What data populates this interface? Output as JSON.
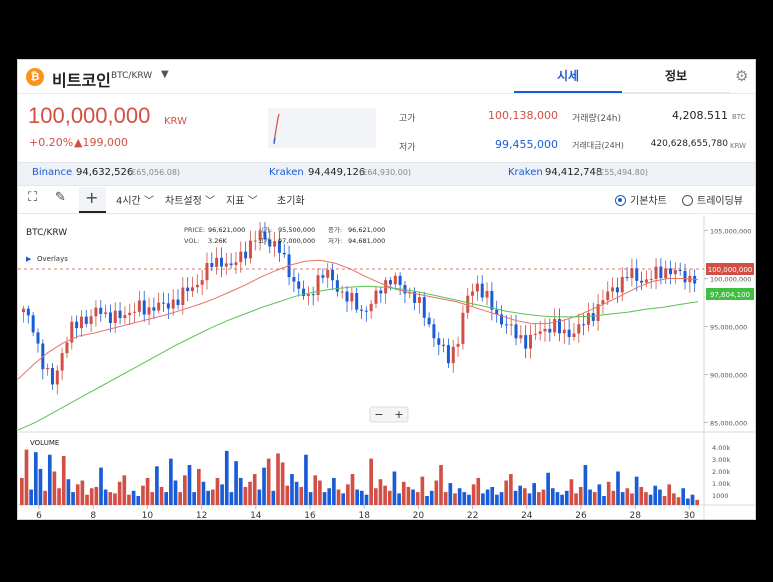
{
  "coin": {
    "logo": "₿",
    "name": "비트코인",
    "pair": "BTC/KRW",
    "caret": "▼"
  },
  "tabs": {
    "market": "시세",
    "info": "정보"
  },
  "icons": {
    "gear": "gear-icon",
    "expand": "expand-icon",
    "pencil": "pencil-icon",
    "crosshair": "crosshair-icon"
  },
  "price": {
    "value": "100,000,000",
    "unit": "KRW",
    "change_pct": "+0.20%",
    "change_amt": "▲199,000"
  },
  "stats": {
    "high_label": "고가",
    "high": "100,138,000",
    "low_label": "저가",
    "low": "99,455,000",
    "volume_label": "거래량(24h)",
    "volume": "4,208.511",
    "volume_unit": "BTC",
    "value_label": "거래대금(24H)",
    "value": "420,628,655,780",
    "value_unit": "KRW"
  },
  "exchanges": [
    {
      "name": "Binance",
      "price": "94,632,526",
      "sub": "(€65,056.08)"
    },
    {
      "name": "Kraken",
      "price": "94,449,126",
      "sub": "(€64,930.00)"
    },
    {
      "name": "Kraken",
      "price": "94,412,748",
      "sub": "(£55,494.80)"
    }
  ],
  "toolbar": {
    "interval": "4시간 ﹀",
    "chart_settings": "차트설정 ﹀",
    "indicators": "지표 ﹀",
    "reset": "초기화",
    "basic_chart": "기본차트",
    "tradingview": "트레이딩뷰"
  },
  "chart_legend": {
    "symbol": "BTC/KRW",
    "overlays": "Overlays",
    "price_label": "PRICE:",
    "price": "96,621,000",
    "open_label": "시가:",
    "open": "95,500,000",
    "close_label": "종가:",
    "close": "96,621,000",
    "vol_label": "VOL:",
    "vol": "3.26K",
    "high_label": "고가:",
    "high": "97,000,000",
    "low_label": "저가:",
    "low": "94,681,000"
  },
  "volume_label": "VOLUME",
  "zoom": {
    "minus": "−",
    "plus": "+"
  },
  "colors": {
    "up": "#d24f45",
    "down": "#1a5bd6",
    "ma_short": "#e57368",
    "ma_long": "#5bc24f",
    "accent": "#1a5bd6"
  },
  "chart_data": {
    "type": "candlestick",
    "series_short_ma_label": "100,000,000",
    "series_long_ma_label": "97,604,100",
    "y_axis_ticks": [
      "105,000,000",
      "100,000,000",
      "95,000,000",
      "90,000,000",
      "85,000,000"
    ],
    "y_range": [
      84000000,
      106000000
    ],
    "volume_ticks": [
      "4.00k",
      "3.00k",
      "2.00k",
      "1.00k",
      "1000"
    ],
    "x_ticks": [
      "6",
      "8",
      "10",
      "12",
      "14",
      "16",
      "18",
      "20",
      "22",
      "24",
      "26",
      "28",
      "30"
    ],
    "close_path": [
      96.5,
      95.2,
      91.0,
      89.0,
      92.0,
      94.5,
      96.0,
      95.5,
      97.0,
      96.0,
      95.8,
      96.5,
      97.0,
      96.5,
      97.5,
      96.8,
      97.8,
      98.5,
      99.0,
      100.5,
      101.5,
      102.0,
      101.0,
      102.5,
      103.5,
      104.5,
      104.0,
      103.0,
      101.0,
      99.0,
      97.5,
      100.0,
      100.5,
      99.5,
      98.0,
      97.5,
      96.5,
      97.5,
      99.5,
      100.0,
      99.0,
      98.5,
      97.0,
      95.0,
      93.0,
      91.5,
      94.0,
      98.0,
      99.5,
      98.0,
      96.0,
      95.5,
      94.0,
      93.5,
      94.0,
      94.5,
      95.5,
      94.0,
      94.5,
      95.0,
      96.0,
      97.5,
      98.5,
      99.5,
      100.5,
      100.0,
      99.8,
      100.5,
      101.0,
      100.5,
      100.2,
      100.0
    ],
    "short_ma": [
      89.5,
      91.0,
      92.3,
      93.3,
      94.0,
      94.3,
      94.7,
      95.1,
      95.5,
      95.9,
      96.3,
      96.8,
      97.3,
      97.9,
      98.6,
      99.3,
      100.1,
      100.8,
      101.4,
      101.8,
      101.9,
      101.6,
      101.0,
      100.2,
      99.5,
      98.9,
      98.5,
      98.2,
      97.9,
      97.6,
      97.1,
      96.6,
      96.1,
      95.6,
      95.3,
      95.3,
      95.6,
      96.1,
      96.8,
      97.5,
      98.3,
      99.1,
      99.7,
      100.0,
      100.0,
      99.9
    ],
    "long_ma": [
      84.2,
      85.0,
      86.0,
      87.0,
      88.0,
      89.0,
      90.0,
      91.0,
      92.0,
      93.0,
      93.9,
      94.8,
      95.6,
      96.3,
      97.0,
      97.6,
      98.2,
      98.6,
      98.9,
      99.1,
      99.2,
      99.1,
      98.9,
      98.6,
      98.2,
      97.8,
      97.4,
      97.0,
      96.6,
      96.3,
      96.1,
      96.0,
      96.0,
      96.1,
      96.3,
      96.5,
      96.8,
      97.0,
      97.3,
      97.6
    ],
    "volumes": [
      2.1,
      4.3,
      1.2,
      4.1,
      2.8,
      1.1,
      3.9,
      2.6,
      1.3,
      3.8,
      2.0,
      1.0,
      1.6,
      1.9,
      0.8,
      1.3,
      1.4,
      2.9,
      1.2,
      1.0,
      0.9,
      1.8,
      2.3,
      0.8,
      1.1,
      0.7,
      1.5,
      2.1,
      1.0,
      3.0,
      1.4,
      1.0,
      3.6,
      1.9,
      1.0,
      2.3,
      3.1,
      1.0,
      2.8,
      1.8,
      1.1,
      1.2,
      2.1,
      1.6,
      4.2,
      1.0,
      3.4,
      2.1,
      1.4,
      1.8,
      2.4,
      1.2,
      2.9,
      3.6,
      1.1,
      4.0,
      3.3,
      1.5,
      2.4,
      1.8,
      1.4,
      3.9,
      1.0,
      2.3,
      1.9,
      1.0,
      1.3,
      2.1,
      1.2,
      0.9,
      1.6,
      2.4,
      1.2,
      1.1,
      0.8,
      3.6,
      1.3,
      2.0,
      1.5,
      1.1,
      2.6,
      0.9,
      1.8,
      1.4,
      1.2,
      1.0,
      2.2,
      0.7,
      1.1,
      1.9,
      3.1,
      1.0,
      1.7,
      0.9,
      1.3,
      1.0,
      0.8,
      1.6,
      2.1,
      0.9,
      1.2,
      1.4,
      0.8,
      1.0,
      1.9,
      2.4,
      1.1,
      1.5,
      1.3,
      0.9,
      1.7,
      1.0,
      1.2,
      2.5,
      1.3,
      1.0,
      0.8,
      1.1,
      2.0,
      0.9,
      1.4,
      3.1,
      1.2,
      1.0,
      1.6,
      0.7,
      1.8,
      1.1,
      2.6,
      1.0,
      1.3,
      0.9,
      2.2,
      1.4,
      1.0,
      0.8,
      1.5,
      1.2,
      0.7,
      1.6,
      0.9,
      0.6,
      1.3,
      0.5,
      0.8,
      0.4
    ]
  }
}
